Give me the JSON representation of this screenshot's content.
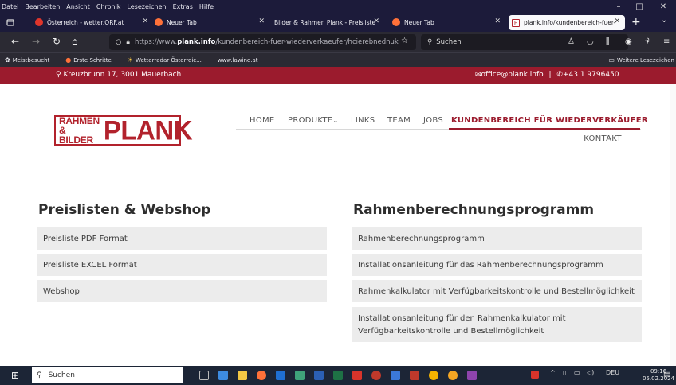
{
  "menubar": [
    "Datei",
    "Bearbeiten",
    "Ansicht",
    "Chronik",
    "Lesezeichen",
    "Extras",
    "Hilfe"
  ],
  "tabs": [
    {
      "label": "Österreich - wetter.ORF.at",
      "color": "#e0352b"
    },
    {
      "label": "Neuer Tab",
      "color": "#ff7139"
    },
    {
      "label": "Bilder & Rahmen Plank - Preisliste",
      "color": "#e0352b"
    },
    {
      "label": "Neuer Tab",
      "color": "#ff7139"
    },
    {
      "label": "plank.info/kundenbereich-fuer-",
      "color": "#b2222c"
    }
  ],
  "url": {
    "prefix": "https://www.",
    "host": "plank.info",
    "path": "/kundenbereich-fuer-wiederverkaeufer/hcierebnednuk"
  },
  "search_placeholder": "Suchen",
  "bookmarks": [
    "Meistbesucht",
    "Erste Schritte",
    "Wetterradar Österreic...",
    "www.lawine.at"
  ],
  "bookmarks_other": "Weitere Lesezeichen",
  "topbar": {
    "address": "Kreuzbrunn 17, 3001 Mauerbach",
    "email": "office@plank.info",
    "phone": "+43 1 9796450"
  },
  "logo": {
    "line1": "RAHMEN",
    "line2": "& BILDER",
    "name": "PLANK"
  },
  "nav": [
    "HOME",
    "PRODUKTE",
    "LINKS",
    "TEAM",
    "JOBS",
    "KUNDENBEREICH FÜR WIEDERVERKÄUFER",
    "KONTAKT"
  ],
  "left": {
    "title": "Preislisten & Webshop",
    "items": [
      "Preisliste PDF Format",
      "Preisliste EXCEL Format",
      "Webshop"
    ]
  },
  "right": {
    "title": "Rahmenberechnungsprogramm",
    "items": [
      "Rahmenberechnungsprogramm",
      "Installationsanleitung für das Rahmenberechnungsprogramm",
      "Rahmenkalkulator mit Verfügbarkeitskontrolle und Bestellmöglichkeit",
      "Installationsanleitung für den Rahmenkalkulator mit",
      "Verfügbarkeitskontrolle und Bestellmöglichkeit"
    ]
  },
  "taskbar": {
    "search": "Suchen",
    "lang": "DEU",
    "time": "09:16",
    "date": "05.02.2024"
  }
}
